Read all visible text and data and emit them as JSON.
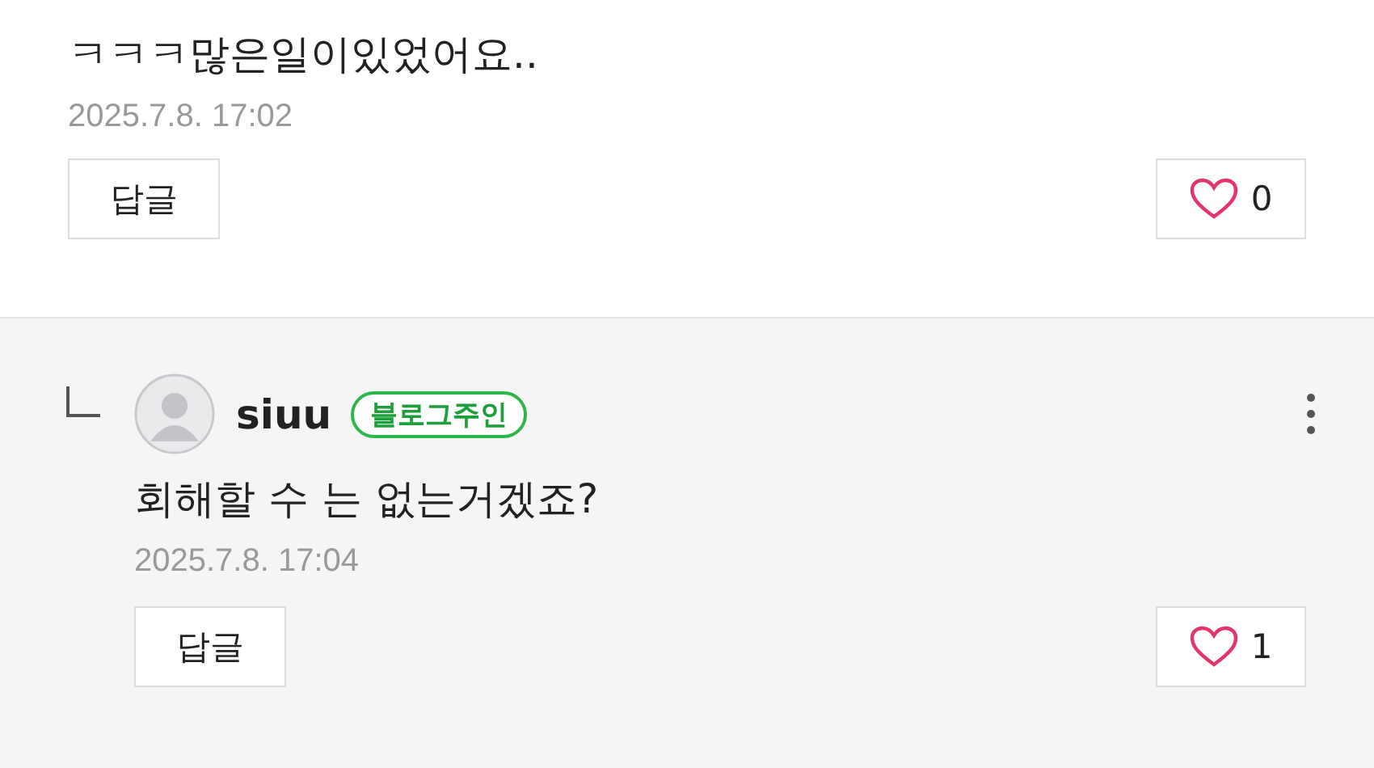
{
  "comments": [
    {
      "kind": "top",
      "text": "ㅋㅋㅋ많은일이있었어요..",
      "date": "2025.7.8. 17:02",
      "reply_label": "답글",
      "like_count": "0"
    },
    {
      "kind": "reply",
      "author": "siuu",
      "badge": "블로그주인",
      "text": "회해할 수 는 없는거겠죠?",
      "date": "2025.7.8. 17:04",
      "reply_label": "답글",
      "like_count": "1"
    }
  ]
}
